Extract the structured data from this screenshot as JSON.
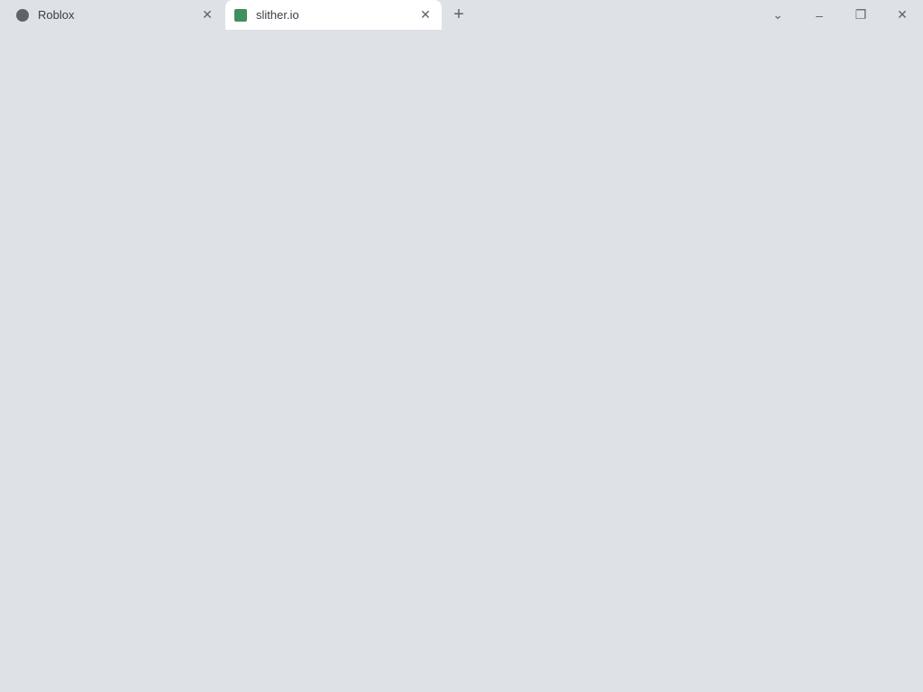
{
  "tabs": [
    {
      "title": "Roblox",
      "favicon": "roblox-globe-icon",
      "active": false
    },
    {
      "title": "slither.io",
      "favicon": "slither-icon",
      "active": true
    }
  ],
  "new_tab_glyph": "+",
  "window_controls": {
    "minimize": "–",
    "restore": "❐",
    "close": "✕"
  }
}
